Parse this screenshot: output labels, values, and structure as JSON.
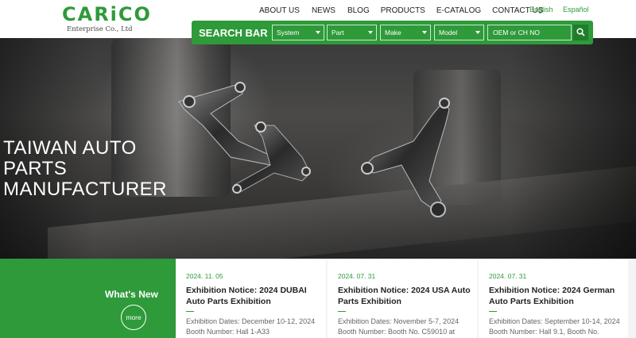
{
  "logo": {
    "word": "CARiCO",
    "sub": "Enterprise Co., Ltd"
  },
  "nav": [
    "ABOUT US",
    "NEWS",
    "BLOG",
    "PRODUCTS",
    "E-CATALOG",
    "CONTACT US"
  ],
  "lang": {
    "en": "English",
    "es": "Español"
  },
  "search": {
    "title": "SEARCH BAR",
    "selects": [
      "System",
      "Part",
      "Make",
      "Model"
    ],
    "input_value": "OEM or CH NO",
    "button_icon": "search-icon"
  },
  "hero": {
    "title_lines": [
      "TAIWAN AUTO",
      "PARTS",
      "MANUFACTURER"
    ]
  },
  "whats_new": {
    "title": "What's New",
    "more": "more",
    "items": [
      {
        "date": "2024. 11. 05",
        "title": "Exhibition Notice: 2024 DUBAI Auto Parts Exhibition",
        "desc": "Exhibition Dates: December 10-12, 2024 Booth Number: Hall 1-A33"
      },
      {
        "date": "2024. 07. 31",
        "title": "Exhibition Notice: 2024 USA Auto Parts Exhibition",
        "desc": "Exhibition Dates: November 5-7, 2024 Booth Number: Booth No. C59010 at"
      },
      {
        "date": "2024. 07. 31",
        "title": "Exhibition Notice: 2024 German Auto Parts Exhibition",
        "desc": "Exhibition Dates: September 10-14, 2024 Booth Number: Hall 9.1, Booth No."
      }
    ]
  },
  "colors": {
    "brand": "#2e9a3a",
    "brand_dark": "#1f7d2b"
  }
}
